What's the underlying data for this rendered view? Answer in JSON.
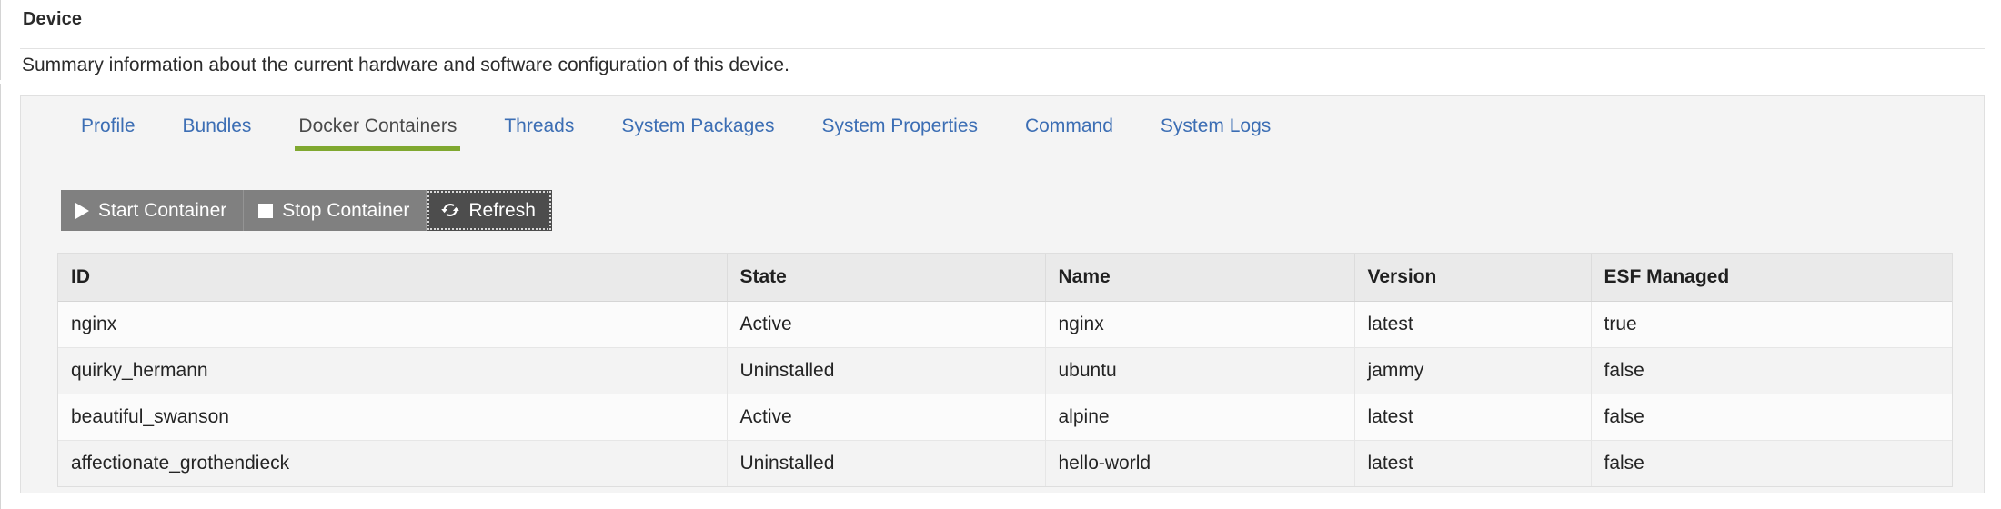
{
  "header": {
    "title": "Device",
    "subtitle": "Summary information about the current hardware and software configuration of this device."
  },
  "tabs": [
    {
      "label": "Profile",
      "active": false
    },
    {
      "label": "Bundles",
      "active": false
    },
    {
      "label": "Docker Containers",
      "active": true
    },
    {
      "label": "Threads",
      "active": false
    },
    {
      "label": "System Packages",
      "active": false
    },
    {
      "label": "System Properties",
      "active": false
    },
    {
      "label": "Command",
      "active": false
    },
    {
      "label": "System Logs",
      "active": false
    }
  ],
  "toolbar": {
    "start_label": "Start Container",
    "stop_label": "Stop Container",
    "refresh_label": "Refresh",
    "start_icon": "play-icon",
    "stop_icon": "stop-icon",
    "refresh_icon": "refresh-icon"
  },
  "table": {
    "columns": [
      "ID",
      "State",
      "Name",
      "Version",
      "ESF Managed"
    ],
    "rows": [
      {
        "id": "nginx",
        "state": "Active",
        "name": "nginx",
        "version": "latest",
        "esf_managed": "true"
      },
      {
        "id": "quirky_hermann",
        "state": "Uninstalled",
        "name": "ubuntu",
        "version": "jammy",
        "esf_managed": "false"
      },
      {
        "id": "beautiful_swanson",
        "state": "Active",
        "name": "alpine",
        "version": "latest",
        "esf_managed": "false"
      },
      {
        "id": "affectionate_grothendieck",
        "state": "Uninstalled",
        "name": "hello-world",
        "version": "latest",
        "esf_managed": "false"
      }
    ]
  },
  "colors": {
    "tab_link": "#3c6eb4",
    "tab_active_underline": "#80a830",
    "button_bg": "#808080",
    "button_focused_bg": "#4d4d4d",
    "panel_bg": "#f4f4f4",
    "table_header_bg": "#eaeaea"
  }
}
